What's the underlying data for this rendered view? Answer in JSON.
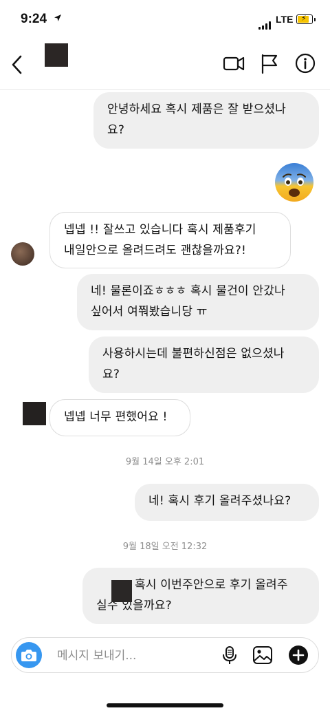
{
  "status_bar": {
    "time": "9:24",
    "network": "LTE"
  },
  "header": {
    "icons": [
      "back-icon",
      "video-call-icon",
      "flag-icon",
      "info-icon"
    ]
  },
  "messages": [
    {
      "text": "안녕하세요 혹시 제품은 잘 받으셨나요?",
      "line1": "안녕하세요 혹시 제품은 잘 받으셨나",
      "line2": "요?",
      "side": "outgoing"
    },
    {
      "reaction": "anxious-face-emoji",
      "side": "outgoing"
    },
    {
      "line1": "넵넵 !! 잘쓰고 있습니다 혹시 제품후기",
      "line2": "내일안으로 올려드려도 괜찮을까요?!",
      "side": "incoming"
    },
    {
      "line1": "네! 물론이죠ㅎㅎㅎ 혹시 물건이 안갔나",
      "line2": "싶어서 여쭤봤습니당 ㅠ",
      "side": "outgoing"
    },
    {
      "line1": "사용하시는데 불편하신점은 없으셨나",
      "line2": "요?",
      "side": "outgoing"
    },
    {
      "line1": "넵넵 너무 편했어요 !",
      "side": "incoming"
    },
    {
      "line1": "네! 혹시 후기 올려주셨나요?",
      "side": "outgoing"
    },
    {
      "line1": "혹시 이번주안으로 후기 올려주",
      "line2": "실수 있을까요?",
      "side": "outgoing"
    }
  ],
  "timestamps": [
    "9월 14일 오후 2:01",
    "9월 18일 오전 12:32"
  ],
  "composer": {
    "placeholder": "메시지 보내기...",
    "icons": [
      "camera-icon",
      "microphone-icon",
      "gallery-icon",
      "add-icon"
    ]
  },
  "colors": {
    "accent": "#3797f0",
    "outgoing_bubble": "#efefef",
    "timestamp": "#8e8e8e"
  }
}
